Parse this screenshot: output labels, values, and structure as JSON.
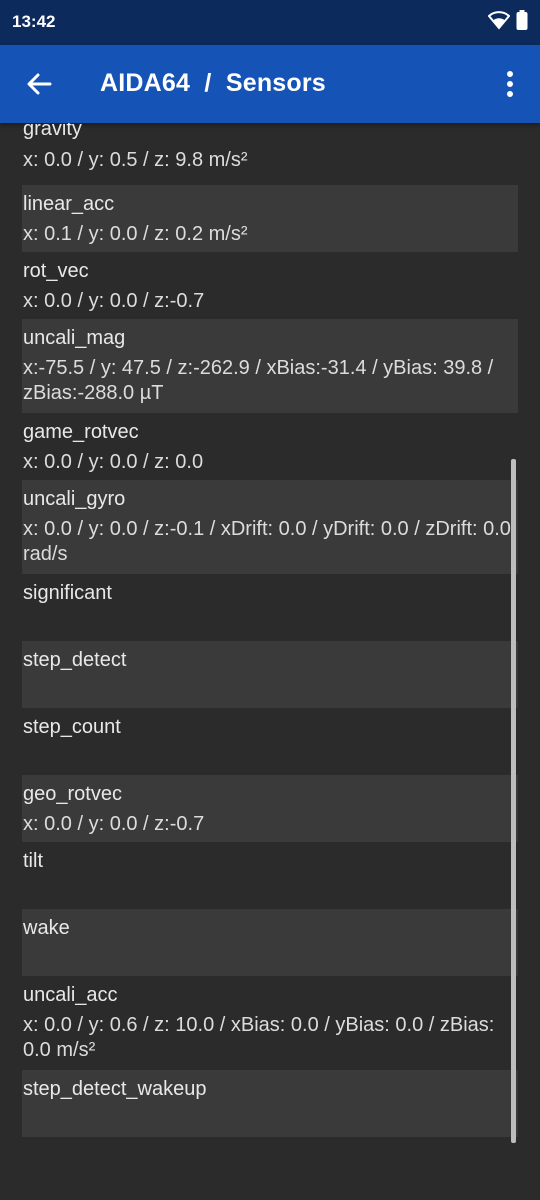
{
  "status_bar": {
    "time": "13:42",
    "icons": [
      "wifi-icon",
      "battery-icon"
    ]
  },
  "app_bar": {
    "back_icon": "arrow-left-icon",
    "title": "AIDA64  /  Sensors",
    "menu_icon": "more-vert-icon"
  },
  "sensors": [
    {
      "name": "gravity",
      "value": "x: 0.0 / y: 0.5 / z: 9.8 m/s²"
    },
    {
      "name": "linear_acc",
      "value": "x: 0.1 / y: 0.0 / z: 0.2 m/s²"
    },
    {
      "name": "rot_vec",
      "value": "x: 0.0 / y: 0.0 / z:-0.7"
    },
    {
      "name": "uncali_mag",
      "value": "x:-75.5 / y: 47.5 / z:-262.9 / xBias:-31.4 / yBias: 39.8 / zBias:-288.0 µT"
    },
    {
      "name": "game_rotvec",
      "value": "x: 0.0 / y: 0.0 / z: 0.0"
    },
    {
      "name": "uncali_gyro",
      "value": "x: 0.0 / y: 0.0 / z:-0.1 / xDrift: 0.0 / yDrift: 0.0 / zDrift: 0.0 rad/s"
    },
    {
      "name": "significant",
      "value": ""
    },
    {
      "name": "step_detect",
      "value": ""
    },
    {
      "name": "step_count",
      "value": ""
    },
    {
      "name": "geo_rotvec",
      "value": "x: 0.0 / y: 0.0 / z:-0.7"
    },
    {
      "name": "tilt",
      "value": ""
    },
    {
      "name": "wake",
      "value": ""
    },
    {
      "name": "uncali_acc",
      "value": "x: 0.0 / y: 0.6 / z: 10.0 / xBias: 0.0 / yBias: 0.0 / zBias: 0.0 m/s²"
    },
    {
      "name": "step_detect_wakeup",
      "value": ""
    }
  ],
  "colors": {
    "status_bar": "#0d2a5c",
    "app_bar": "#1553b6",
    "background": "#2b2b2b",
    "alt_row": "#3a3a3a",
    "text": "#e8e8e8"
  }
}
